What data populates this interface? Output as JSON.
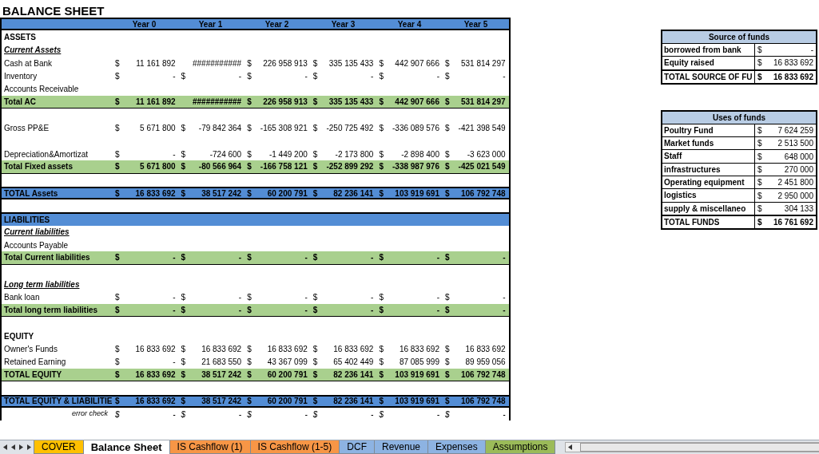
{
  "title": "BALANCE SHEET",
  "columns": [
    "Year 0",
    "Year 1",
    "Year 2",
    "Year 3",
    "Year 4",
    "Year 5"
  ],
  "rows": [
    {
      "kind": "section",
      "label": "ASSETS"
    },
    {
      "kind": "subsection",
      "label": "Current Assets"
    },
    {
      "kind": "item",
      "label": "Cash at Bank",
      "cells": [
        {
          "currency": "$",
          "value": "11 161 892"
        },
        {
          "value": "###########"
        },
        {
          "currency": "$",
          "value": "226 958 913"
        },
        {
          "currency": "$",
          "value": "335 135 433"
        },
        {
          "currency": "$",
          "value": "442 907 666"
        },
        {
          "currency": "$",
          "value": "531 814 297"
        }
      ]
    },
    {
      "kind": "item",
      "label": "Inventory",
      "cells": [
        {
          "currency": "$",
          "value": "-"
        },
        {
          "currency": "$",
          "value": "-"
        },
        {
          "currency": "$",
          "value": "-"
        },
        {
          "currency": "$",
          "value": "-"
        },
        {
          "currency": "$",
          "value": "-"
        },
        {
          "currency": "$",
          "value": "-"
        }
      ]
    },
    {
      "kind": "item",
      "label": "Accounts Receivable"
    },
    {
      "kind": "total",
      "label": "Total AC",
      "cells": [
        {
          "currency": "$",
          "value": "11 161 892"
        },
        {
          "value": "###########"
        },
        {
          "currency": "$",
          "value": "226 958 913"
        },
        {
          "currency": "$",
          "value": "335 135 433"
        },
        {
          "currency": "$",
          "value": "442 907 666"
        },
        {
          "currency": "$",
          "value": "531 814 297"
        }
      ]
    },
    {
      "kind": "blank"
    },
    {
      "kind": "item",
      "label": "Gross PP&E",
      "cells": [
        {
          "currency": "$",
          "value": "5 671 800"
        },
        {
          "currency": "$",
          "value": "-79 842 364"
        },
        {
          "currency": "$",
          "value": "-165 308 921"
        },
        {
          "currency": "$",
          "value": "-250 725 492"
        },
        {
          "currency": "$",
          "value": "-336 089 576"
        },
        {
          "currency": "$",
          "value": "-421 398 549"
        }
      ]
    },
    {
      "kind": "blank"
    },
    {
      "kind": "item",
      "label": "Depreciation&Amortizat",
      "cells": [
        {
          "currency": "$",
          "value": "-"
        },
        {
          "currency": "$",
          "value": "-724 600"
        },
        {
          "currency": "$",
          "value": "-1 449 200"
        },
        {
          "currency": "$",
          "value": "-2 173 800"
        },
        {
          "currency": "$",
          "value": "-2 898 400"
        },
        {
          "currency": "$",
          "value": "-3 623 000"
        }
      ]
    },
    {
      "kind": "total",
      "label": "Total Fixed assets",
      "cells": [
        {
          "currency": "$",
          "value": "5 671 800"
        },
        {
          "currency": "$",
          "value": "-80 566 964"
        },
        {
          "currency": "$",
          "value": "-166 758 121"
        },
        {
          "currency": "$",
          "value": "-252 899 292"
        },
        {
          "currency": "$",
          "value": "-338 987 976"
        },
        {
          "currency": "$",
          "value": "-425 021 549"
        }
      ]
    },
    {
      "kind": "blank"
    },
    {
      "kind": "grand",
      "label": "TOTAL Assets",
      "cells": [
        {
          "currency": "$",
          "value": "16 833 692"
        },
        {
          "currency": "$",
          "value": "38 517 242"
        },
        {
          "currency": "$",
          "value": "60 200 791"
        },
        {
          "currency": "$",
          "value": "82 236 141"
        },
        {
          "currency": "$",
          "value": "103 919 691"
        },
        {
          "currency": "$",
          "value": "106 792 748"
        }
      ]
    },
    {
      "kind": "gap"
    },
    {
      "kind": "band",
      "label": "LIABILITIES"
    },
    {
      "kind": "subsection",
      "label": "Current liabilities"
    },
    {
      "kind": "item",
      "label": "Accounts Payable"
    },
    {
      "kind": "total",
      "label": "Total Current liabilities",
      "cells": [
        {
          "currency": "$",
          "value": "-"
        },
        {
          "currency": "$",
          "value": "-"
        },
        {
          "currency": "$",
          "value": "-"
        },
        {
          "currency": "$",
          "value": "-"
        },
        {
          "currency": "$",
          "value": "-"
        },
        {
          "currency": "$",
          "value": "-"
        }
      ]
    },
    {
      "kind": "blank"
    },
    {
      "kind": "subsection",
      "label": "Long term liabilities"
    },
    {
      "kind": "item",
      "label": "Bank loan",
      "cells": [
        {
          "currency": "$",
          "value": "-"
        },
        {
          "currency": "$",
          "value": "-"
        },
        {
          "currency": "$",
          "value": "-"
        },
        {
          "currency": "$",
          "value": "-"
        },
        {
          "currency": "$",
          "value": "-"
        },
        {
          "currency": "$",
          "value": "-"
        }
      ]
    },
    {
      "kind": "total",
      "label": "Total long term liabilities",
      "cells": [
        {
          "currency": "$",
          "value": "-"
        },
        {
          "currency": "$",
          "value": "-"
        },
        {
          "currency": "$",
          "value": "-"
        },
        {
          "currency": "$",
          "value": "-"
        },
        {
          "currency": "$",
          "value": "-"
        },
        {
          "currency": "$",
          "value": "-"
        }
      ]
    },
    {
      "kind": "blank"
    },
    {
      "kind": "section",
      "label": "EQUITY"
    },
    {
      "kind": "item",
      "label": "Owner's Funds",
      "cells": [
        {
          "currency": "$",
          "value": "16 833 692"
        },
        {
          "currency": "$",
          "value": "16 833 692"
        },
        {
          "currency": "$",
          "value": "16 833 692"
        },
        {
          "currency": "$",
          "value": "16 833 692"
        },
        {
          "currency": "$",
          "value": "16 833 692"
        },
        {
          "currency": "$",
          "value": "16 833 692"
        }
      ]
    },
    {
      "kind": "item",
      "label": "Retained Earning",
      "cells": [
        {
          "currency": "$",
          "value": "-"
        },
        {
          "currency": "$",
          "value": "21 683 550"
        },
        {
          "currency": "$",
          "value": "43 367 099"
        },
        {
          "currency": "$",
          "value": "65 402 449"
        },
        {
          "currency": "$",
          "value": "87 085 999"
        },
        {
          "currency": "$",
          "value": "89 959 056"
        }
      ]
    },
    {
      "kind": "total",
      "label": "TOTAL EQUITY",
      "cells": [
        {
          "currency": "$",
          "value": "16 833 692"
        },
        {
          "currency": "$",
          "value": "38 517 242"
        },
        {
          "currency": "$",
          "value": "60 200 791"
        },
        {
          "currency": "$",
          "value": "82 236 141"
        },
        {
          "currency": "$",
          "value": "103 919 691"
        },
        {
          "currency": "$",
          "value": "106 792 748"
        }
      ]
    },
    {
      "kind": "blank"
    },
    {
      "kind": "grand",
      "label": "TOTAL EQUITY & LIABILITIE",
      "cells": [
        {
          "currency": "$",
          "value": "16 833 692"
        },
        {
          "currency": "$",
          "value": "38 517 242"
        },
        {
          "currency": "$",
          "value": "60 200 791"
        },
        {
          "currency": "$",
          "value": "82 236 141"
        },
        {
          "currency": "$",
          "value": "103 919 691"
        },
        {
          "currency": "$",
          "value": "106 792 748"
        }
      ]
    },
    {
      "kind": "check",
      "label": "error check",
      "cells": [
        {
          "currency": "$",
          "value": "-"
        },
        {
          "currency": "$",
          "value": "-"
        },
        {
          "currency": "$",
          "value": "-"
        },
        {
          "currency": "$",
          "value": "-"
        },
        {
          "currency": "$",
          "value": "-"
        },
        {
          "currency": "$",
          "value": "-"
        }
      ]
    }
  ],
  "side_tables": [
    {
      "title": "Source of funds",
      "rows": [
        {
          "label": "borrowed from bank",
          "currency": "$",
          "value": "-"
        },
        {
          "label": "Equity raised",
          "currency": "$",
          "value": "16 833 692"
        }
      ],
      "total": {
        "label": "TOTAL SOURCE OF FU",
        "currency": "$",
        "value": "16 833 692"
      }
    },
    {
      "title": "Uses of funds",
      "rows": [
        {
          "label": "Poultry Fund",
          "currency": "$",
          "value": "7 624 259"
        },
        {
          "label": "Market funds",
          "currency": "$",
          "value": "2 513 500"
        },
        {
          "label": "Staff",
          "currency": "$",
          "value": "648 000"
        },
        {
          "label": "infrastructures",
          "currency": "$",
          "value": "270 000"
        },
        {
          "label": "Operating equipment",
          "currency": "$",
          "value": "2 451 800"
        },
        {
          "label": "logistics",
          "currency": "$",
          "value": "2 950 000"
        },
        {
          "label": "supply & miscellaneo",
          "currency": "$",
          "value": "304 133"
        }
      ],
      "total": {
        "label": "TOTAL FUNDS",
        "currency": "$",
        "value": "16 761 692"
      }
    }
  ],
  "sheet_tabs": [
    {
      "label": "COVER",
      "color": "#ffc000",
      "selected": false
    },
    {
      "label": "Balance Sheet",
      "color": "#ffffff",
      "selected": true
    },
    {
      "label": "IS Cashflow (1)",
      "color": "#f79646",
      "selected": false
    },
    {
      "label": "IS Cashflow (1-5)",
      "color": "#f79646",
      "selected": false
    },
    {
      "label": "DCF",
      "color": "#8db3e2",
      "selected": false
    },
    {
      "label": "Revenue",
      "color": "#8db3e2",
      "selected": false
    },
    {
      "label": "Expenses",
      "color": "#8db3e2",
      "selected": false
    },
    {
      "label": "Assumptions",
      "color": "#9bbb59",
      "selected": false
    }
  ]
}
